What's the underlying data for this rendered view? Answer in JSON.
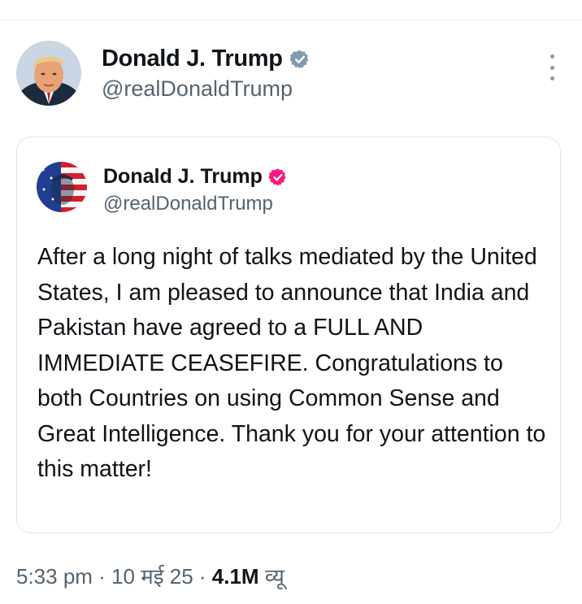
{
  "tweet": {
    "author_name": "Donald J. Trump",
    "author_handle": "@realDonaldTrump",
    "verified_color": "#829aab",
    "more_icon": "more-vertical-icon"
  },
  "quoted_post": {
    "author_name": "Donald J. Trump",
    "author_handle": "@realDonaldTrump",
    "verified_color": "#f91880",
    "text": "After a long night of talks mediated by the United States, I am pleased to announce that India and Pakistan have agreed to a FULL AND IMMEDIATE CEASEFIRE. Congratulations to both Countries on using Common Sense and Great Intelligence. Thank you for your attention to this matter!"
  },
  "meta": {
    "time": "5:33 pm",
    "separator": " · ",
    "date": "10 मई 25",
    "views_count": "4.1M",
    "views_label": "व्यू"
  }
}
